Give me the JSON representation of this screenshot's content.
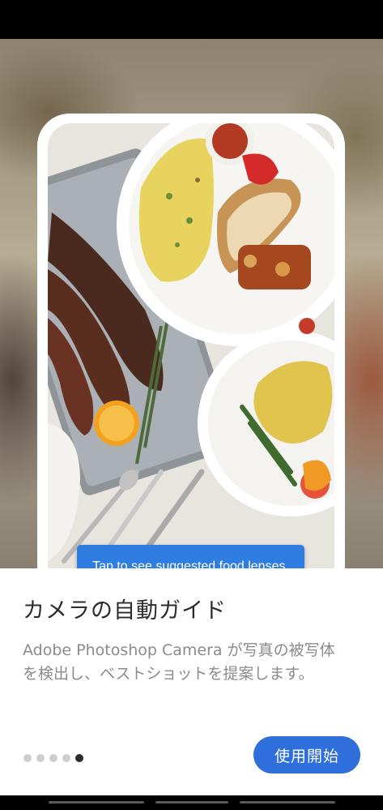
{
  "tooltip": {
    "text": "Tap to see suggested food lenses."
  },
  "onboarding": {
    "title": "カメラの自動ガイド",
    "description_line1": "Adobe Photoshop Camera が写真の被写体",
    "description_line2": "を検出し、ベストショットを提案します。",
    "cta_label": "使用開始",
    "page_dots": {
      "total": 5,
      "active_index": 4
    }
  },
  "colors": {
    "accent": "#2f6fdc",
    "tooltip": "#2f7de1",
    "title_text": "#2c2c2c",
    "body_text": "#8b8b8b"
  }
}
